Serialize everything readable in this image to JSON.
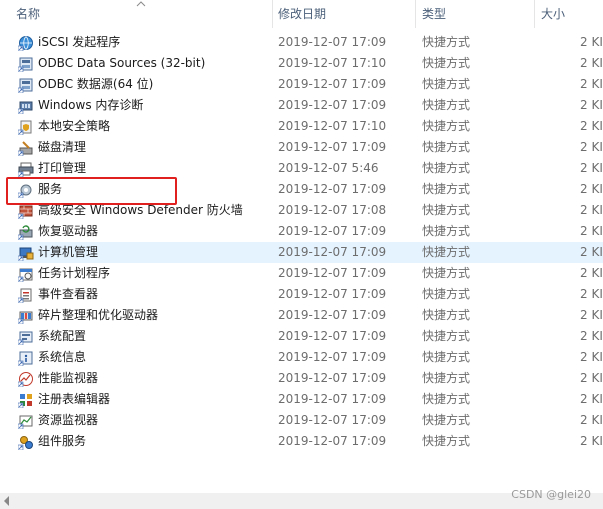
{
  "columns": {
    "name": "名称",
    "date": "修改日期",
    "type": "类型",
    "size": "大小"
  },
  "rows": [
    {
      "name": "iSCSI 发起程序",
      "date": "2019-12-07 17:09",
      "type": "快捷方式",
      "size": "2 KI",
      "icon": "globe-icon"
    },
    {
      "name": "ODBC Data Sources (32-bit)",
      "date": "2019-12-07 17:10",
      "type": "快捷方式",
      "size": "2 KI",
      "icon": "database-icon"
    },
    {
      "name": "ODBC 数据源(64 位)",
      "date": "2019-12-07 17:09",
      "type": "快捷方式",
      "size": "2 KI",
      "icon": "database-icon"
    },
    {
      "name": "Windows 内存诊断",
      "date": "2019-12-07 17:09",
      "type": "快捷方式",
      "size": "2 KI",
      "icon": "memory-chip-icon"
    },
    {
      "name": "本地安全策略",
      "date": "2019-12-07 17:10",
      "type": "快捷方式",
      "size": "2 KI",
      "icon": "security-policy-icon"
    },
    {
      "name": "磁盘清理",
      "date": "2019-12-07 17:09",
      "type": "快捷方式",
      "size": "2 KI",
      "icon": "disk-cleanup-icon"
    },
    {
      "name": "打印管理",
      "date": "2019-12-07 5:46",
      "type": "快捷方式",
      "size": "2 KI",
      "icon": "printer-icon"
    },
    {
      "name": "服务",
      "date": "2019-12-07 17:09",
      "type": "快捷方式",
      "size": "2 KI",
      "icon": "services-gear-icon"
    },
    {
      "name": "高级安全 Windows Defender 防火墙",
      "date": "2019-12-07 17:08",
      "type": "快捷方式",
      "size": "2 KI",
      "icon": "firewall-icon"
    },
    {
      "name": "恢复驱动器",
      "date": "2019-12-07 17:09",
      "type": "快捷方式",
      "size": "2 KI",
      "icon": "recovery-drive-icon"
    },
    {
      "name": "计算机管理",
      "date": "2019-12-07 17:09",
      "type": "快捷方式",
      "size": "2 KI",
      "icon": "computer-management-icon"
    },
    {
      "name": "任务计划程序",
      "date": "2019-12-07 17:09",
      "type": "快捷方式",
      "size": "2 KI",
      "icon": "task-scheduler-icon"
    },
    {
      "name": "事件查看器",
      "date": "2019-12-07 17:09",
      "type": "快捷方式",
      "size": "2 KI",
      "icon": "event-viewer-icon"
    },
    {
      "name": "碎片整理和优化驱动器",
      "date": "2019-12-07 17:09",
      "type": "快捷方式",
      "size": "2 KI",
      "icon": "defrag-icon"
    },
    {
      "name": "系统配置",
      "date": "2019-12-07 17:09",
      "type": "快捷方式",
      "size": "2 KI",
      "icon": "system-config-icon"
    },
    {
      "name": "系统信息",
      "date": "2019-12-07 17:09",
      "type": "快捷方式",
      "size": "2 KI",
      "icon": "system-info-icon"
    },
    {
      "name": "性能监视器",
      "date": "2019-12-07 17:09",
      "type": "快捷方式",
      "size": "2 KI",
      "icon": "performance-monitor-icon"
    },
    {
      "name": "注册表编辑器",
      "date": "2019-12-07 17:09",
      "type": "快捷方式",
      "size": "2 KI",
      "icon": "registry-editor-icon"
    },
    {
      "name": "资源监视器",
      "date": "2019-12-07 17:09",
      "type": "快捷方式",
      "size": "2 KI",
      "icon": "resource-monitor-icon"
    },
    {
      "name": "组件服务",
      "date": "2019-12-07 17:09",
      "type": "快捷方式",
      "size": "2 KI",
      "icon": "component-services-icon"
    }
  ],
  "watermark": "CSDN @glei20",
  "colors": {
    "header_text": "#4c607a",
    "hover_row": "#e5f3ff",
    "highlight": "#e0201f"
  }
}
